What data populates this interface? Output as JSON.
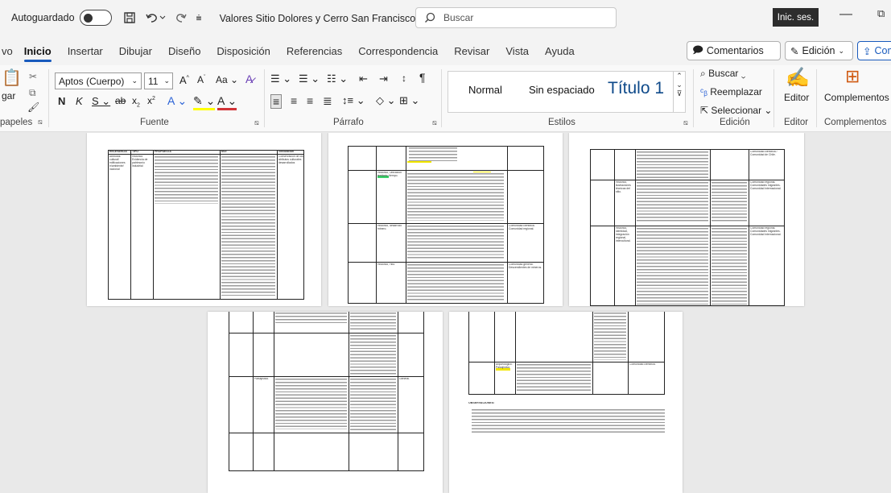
{
  "titlebar": {
    "autosave_label": "Autoguardado",
    "doc_title": "Valores Sitio Dolores y Cerro San Francisco. Propue... ∨",
    "search_placeholder": "Buscar",
    "signin_label": "Inic. ses."
  },
  "tabs": [
    "vo",
    "Inicio",
    "Insertar",
    "Dibujar",
    "Diseño",
    "Disposición",
    "Referencias",
    "Correspondencia",
    "Revisar",
    "Vista",
    "Ayuda"
  ],
  "tab_buttons": {
    "comments": "Comentarios",
    "editing": "Edición",
    "share": "Comp"
  },
  "ribbon": {
    "font_name": "Aptos (Cuerpo)",
    "font_size": "11",
    "clipboard_label": "papeles",
    "font_label": "Fuente",
    "paragraph_label": "Párrafo",
    "styles_label": "Estilos",
    "editing_label": "Edición",
    "editor_label": "Editor",
    "addins_label": "Complementos",
    "paste_label": "gar",
    "styles": [
      "Normal",
      "Sin espaciado",
      "Título 1"
    ],
    "find_label": "Buscar",
    "replace_label": "Reemplazar",
    "select_label": "Seleccionar",
    "editor_button": "Editor",
    "addins_button": "Complementos"
  },
  "doc": {
    "p1_headers": [
      "RELEVANCIA",
      "TIPO",
      "PROPUESTA",
      "MOI",
      "Vinculación"
    ],
    "p1_col1": "Atributos: cultural/ edificaciones e/ambiente/ nacional",
    "p1_col2": "Histórico. Evidencia de patrimonio industrial",
    "p1_col5": "Conservación de los atributos culturales desarrollados",
    "p2_rows": [
      "Histórico, Ubicación territorio, tiempo.",
      "Histórico, desarrollo minero.",
      "Histórico, Hito."
    ],
    "p2_right": [
      "Comunidad científica. Comunidad regional.",
      "Comunidad general. Descendientes de mineros."
    ],
    "p3_rows": [
      "Histórico, ilustraciones técnicas del sitio.",
      "Histórico, identidad, integración regional, intercultural."
    ],
    "p3_right": [
      "Comunidad científica / Comunidad de Chile.",
      "Comunidad regional. Comunidades migrantes. Comunidad internacional.",
      "Comunidad regional. Comunidades migrantes. Comunidad internacional."
    ],
    "p4_row": "Paisajístico.",
    "p4_right": "General.",
    "p5_row": "Arqueológico. Paisajístico.",
    "p5_right": "Comunidad científica.",
    "p5_obs": "OBSERVACIONES:"
  }
}
